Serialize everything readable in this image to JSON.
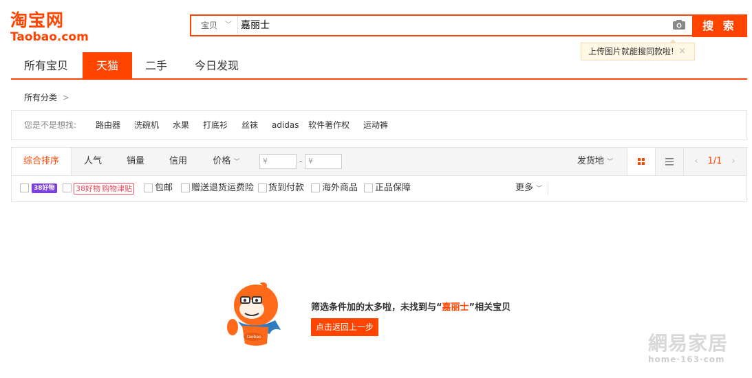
{
  "logo": {
    "cn": "淘宝网",
    "en": "Taobao.com"
  },
  "search": {
    "scope": "宝贝",
    "query": "嘉丽士",
    "button": "搜 索",
    "tip": "上传图片就能搜同款啦!",
    "tip_close": "×"
  },
  "tabs": [
    {
      "label": "所有宝贝",
      "active": false
    },
    {
      "label": "天猫",
      "active": true
    },
    {
      "label": "二手",
      "active": false
    },
    {
      "label": "今日发现",
      "active": false
    }
  ],
  "breadcrumb": {
    "label": "所有分类",
    "chevron": ">"
  },
  "suggest": {
    "label": "您是不是想找:",
    "keywords": [
      "路由器",
      "洗碗机",
      "水果",
      "打底衫",
      "丝袜",
      "adidas",
      "软件著作权",
      "运动裤"
    ]
  },
  "sort": {
    "items": [
      "综合排序",
      "人气",
      "销量",
      "信用",
      "价格"
    ],
    "active": "综合排序",
    "price_from": "¥",
    "price_to": "¥",
    "dash": "-",
    "location": "发货地",
    "pager": "1/1"
  },
  "filters": {
    "tag1": "38好物",
    "tag2a": "38好物",
    "tag2b": "购物津贴",
    "items": [
      "包邮",
      "赠送退货运费险",
      "货到付款",
      "海外商品",
      "正品保障"
    ],
    "more": "更多"
  },
  "empty": {
    "msg_pre": "筛选条件加的太多啦，未找到与“",
    "keyword": "嘉丽士",
    "msg_post": "”相关宝贝",
    "back_button": "点击返回上一步",
    "mascot_text": "taobao"
  },
  "watermark": {
    "cn": "網易家居",
    "en": "home·163·com"
  },
  "colors": {
    "accent": "#ff4400",
    "tip_bg": "#fff8e5",
    "purple_tag": "#7b3fe4",
    "red_tag": "#e84c5f"
  }
}
